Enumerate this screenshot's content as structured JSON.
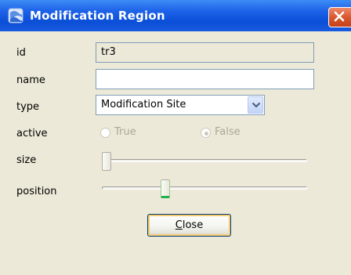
{
  "window": {
    "title": "Modification Region",
    "title_icon": "app-icon",
    "close_icon": "close-icon"
  },
  "fields": {
    "id": {
      "label": "id",
      "value": "tr3"
    },
    "name": {
      "label": "name",
      "value": ""
    },
    "type": {
      "label": "type",
      "value": "Modification Site"
    },
    "active": {
      "label": "active",
      "options": [
        "True",
        "False"
      ],
      "selected": "False"
    },
    "size": {
      "label": "size",
      "level": 0.0
    },
    "position": {
      "label": "position",
      "level": 0.3
    }
  },
  "buttons": {
    "close_label": "Close"
  },
  "colors": {
    "titlebar": "#0b4fd8",
    "panel": "#ece9d8",
    "close_button": "#d9582f"
  }
}
